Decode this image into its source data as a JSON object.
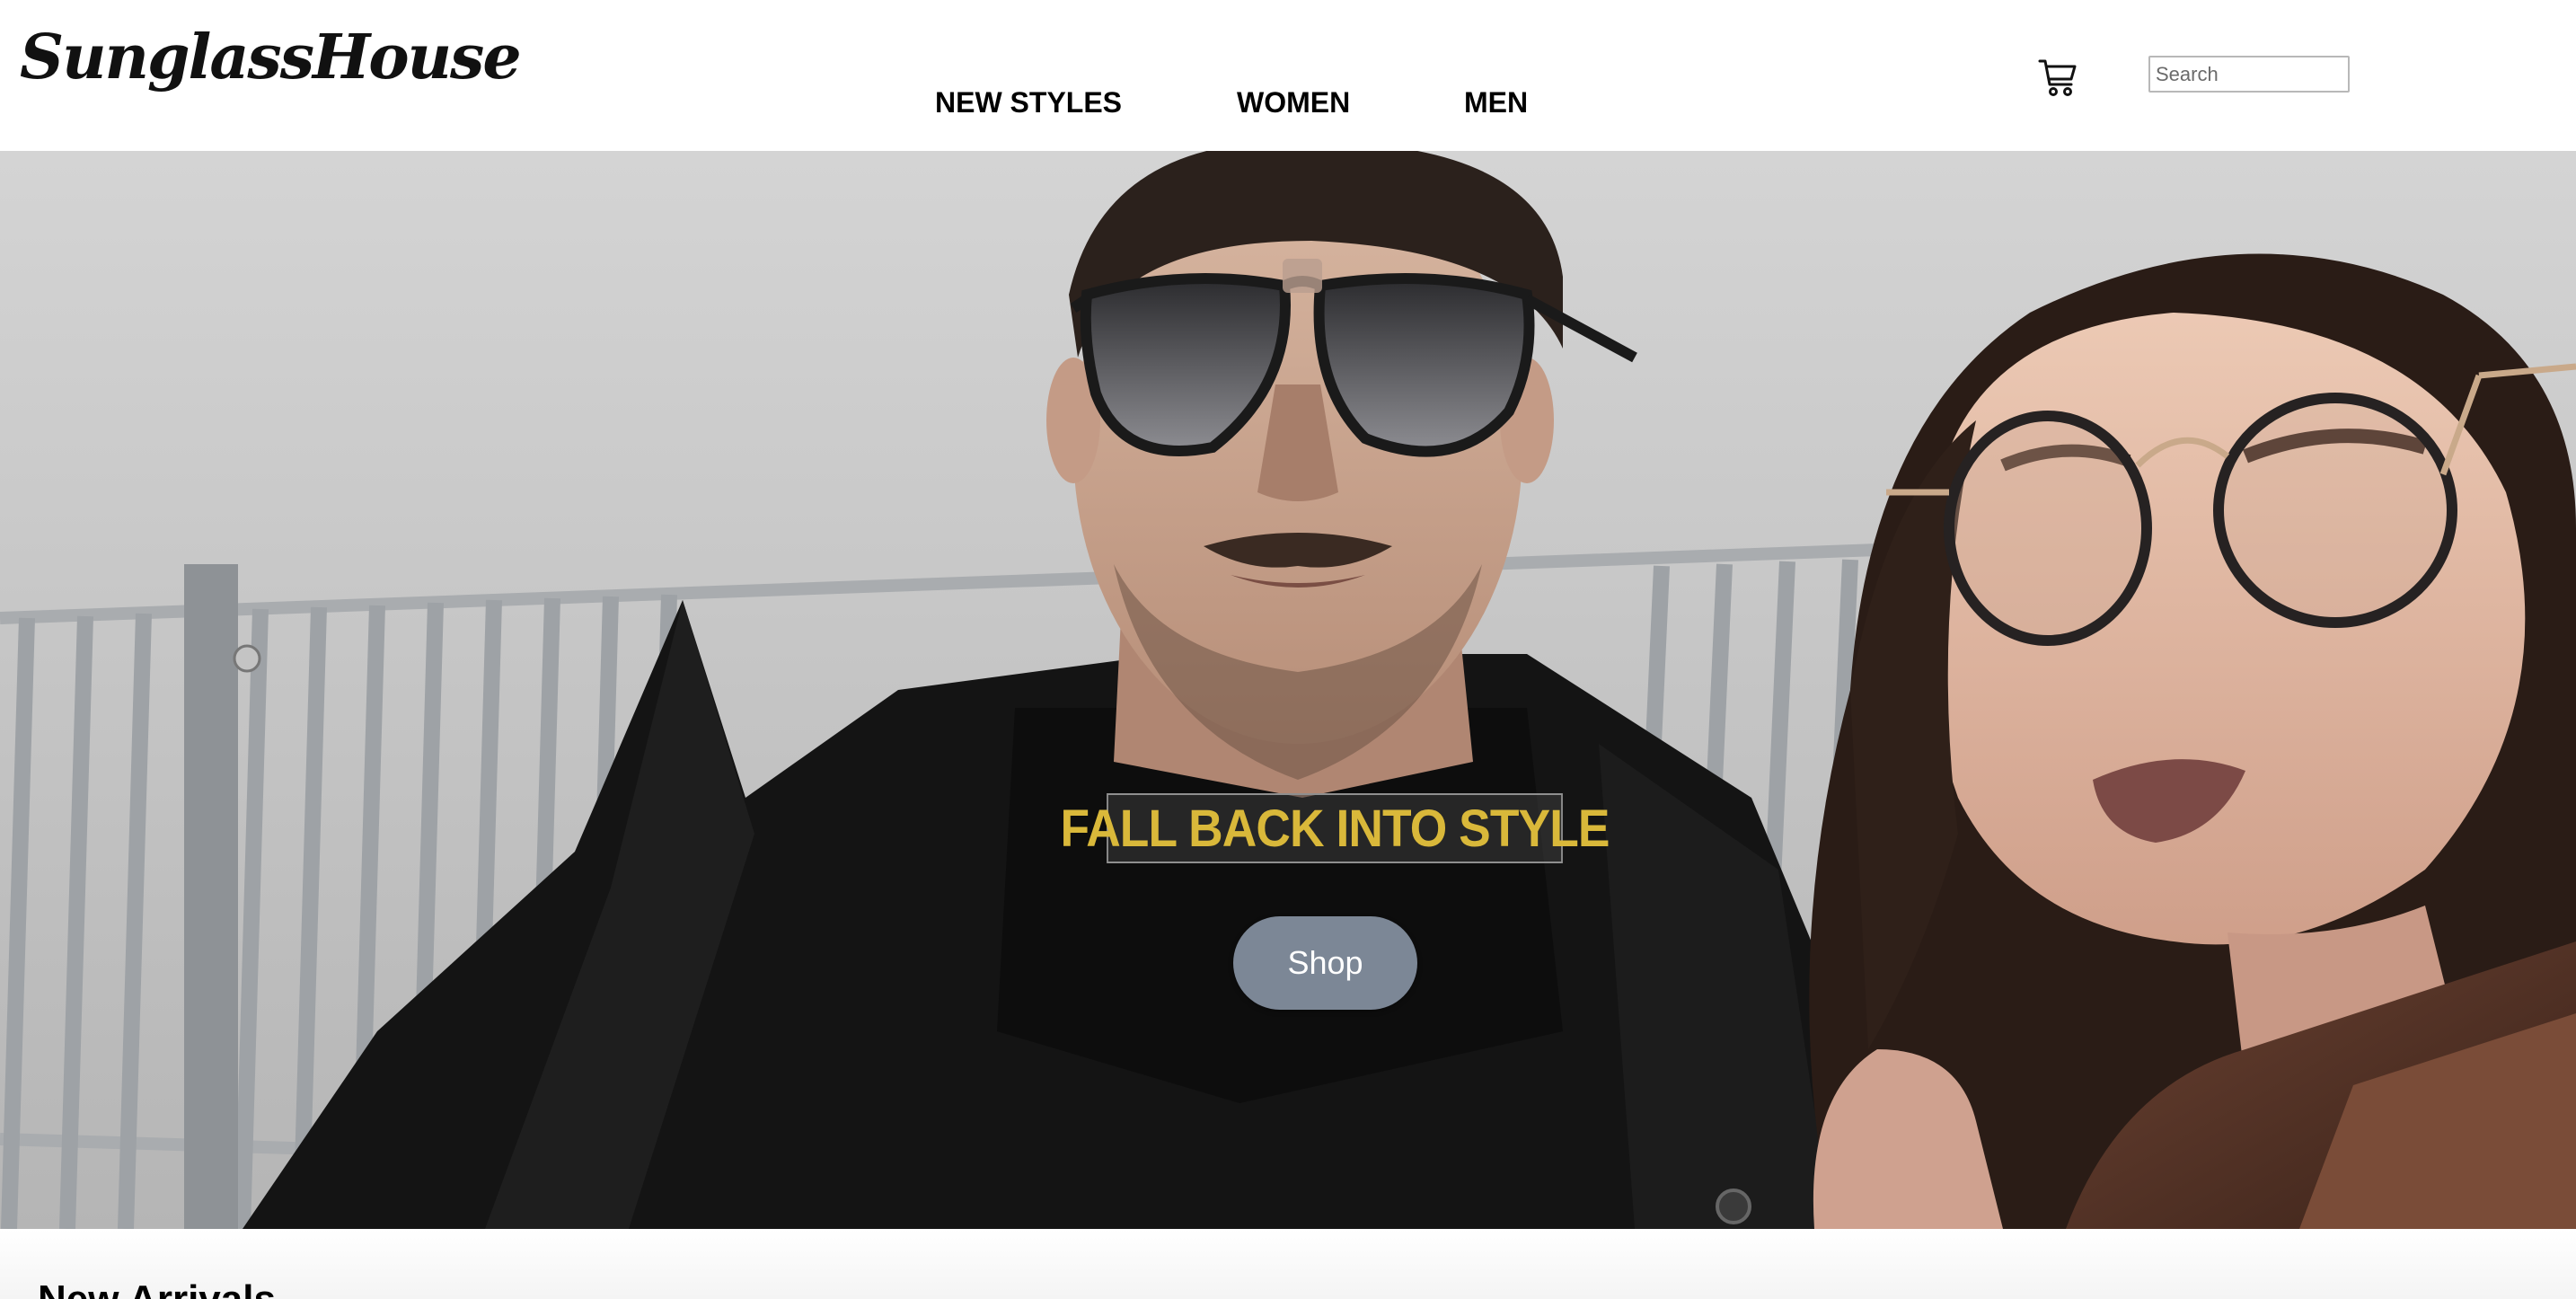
{
  "brand": {
    "logo_text": "SunglassHouse"
  },
  "nav": {
    "items": [
      {
        "label": "NEW STYLES"
      },
      {
        "label": "WOMEN"
      },
      {
        "label": "MEN"
      }
    ]
  },
  "header": {
    "cart_icon": "shopping-cart-icon",
    "search": {
      "placeholder": "Search",
      "value": ""
    }
  },
  "hero": {
    "headline": "FALL BACK INTO STYLE",
    "headline_color": "#d9b83a",
    "shop_label": "Shop",
    "shop_color": "#7c8796"
  },
  "section": {
    "title": "New Arrivals"
  }
}
